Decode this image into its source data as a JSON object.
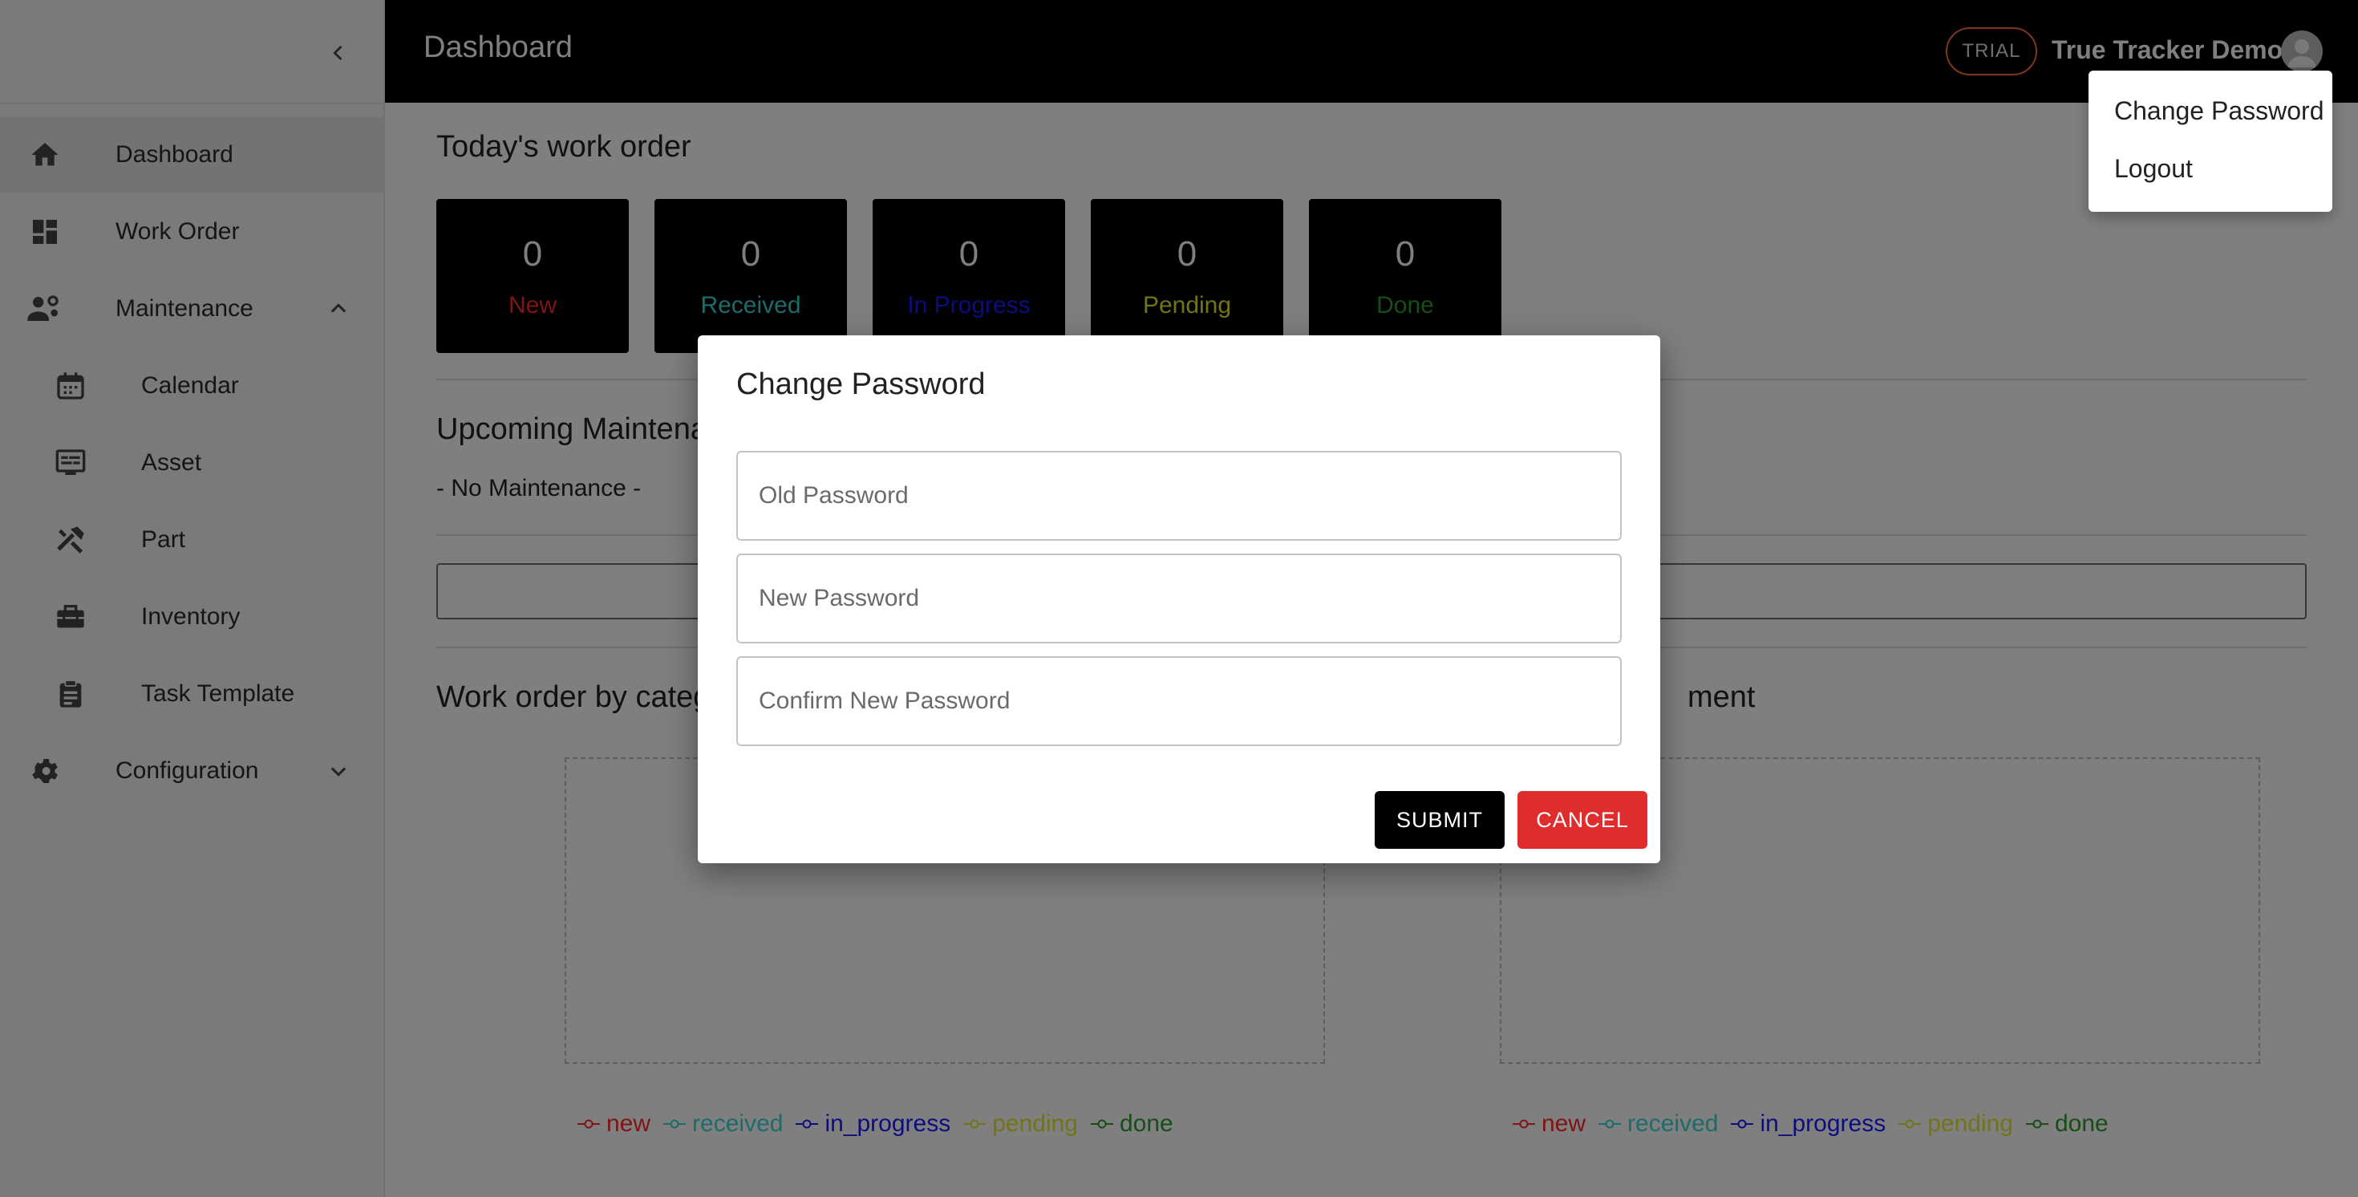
{
  "sidebar": {
    "items": [
      {
        "label": "Dashboard",
        "icon": "home-icon"
      },
      {
        "label": "Work Order",
        "icon": "dashboard-grid-icon"
      },
      {
        "label": "Maintenance",
        "icon": "users-gear-icon"
      },
      {
        "label": "Calendar",
        "icon": "calendar-icon"
      },
      {
        "label": "Asset",
        "icon": "asset-list-icon"
      },
      {
        "label": "Part",
        "icon": "tools-icon"
      },
      {
        "label": "Inventory",
        "icon": "toolbox-icon"
      },
      {
        "label": "Task Template",
        "icon": "clipboard-icon"
      },
      {
        "label": "Configuration",
        "icon": "gear-icon"
      }
    ]
  },
  "header": {
    "title": "Dashboard",
    "trial_badge": "TRIAL",
    "user_name": "True Tracker Demo"
  },
  "main": {
    "todays_title": "Today's work order",
    "stats": [
      {
        "value": "0",
        "label": "New",
        "color": "#ff2a2a"
      },
      {
        "value": "0",
        "label": "Received",
        "color": "#3bd6d6"
      },
      {
        "value": "0",
        "label": "In Progress",
        "color": "#1a1aff"
      },
      {
        "value": "0",
        "label": "Pending",
        "color": "#e6e62e"
      },
      {
        "value": "0",
        "label": "Done",
        "color": "#2f9a2f"
      }
    ],
    "upcoming_title": "Upcoming Maintena",
    "no_maintenance": "- No Maintenance -",
    "chart_left_title": "Work order by categ",
    "chart_right_title": "ment",
    "legend": [
      {
        "label": "new",
        "color": "#ff2a2a"
      },
      {
        "label": "received",
        "color": "#3bd6d6"
      },
      {
        "label": "in_progress",
        "color": "#1a1aff"
      },
      {
        "label": "pending",
        "color": "#e6e62e"
      },
      {
        "label": "done",
        "color": "#2f9a2f"
      }
    ]
  },
  "user_menu": {
    "change_password": "Change Password",
    "logout": "Logout"
  },
  "dialog": {
    "title": "Change Password",
    "old_password_placeholder": "Old Password",
    "new_password_placeholder": "New Password",
    "confirm_password_placeholder": "Confirm New Password",
    "submit_label": "SUBMIT",
    "cancel_label": "CANCEL"
  }
}
